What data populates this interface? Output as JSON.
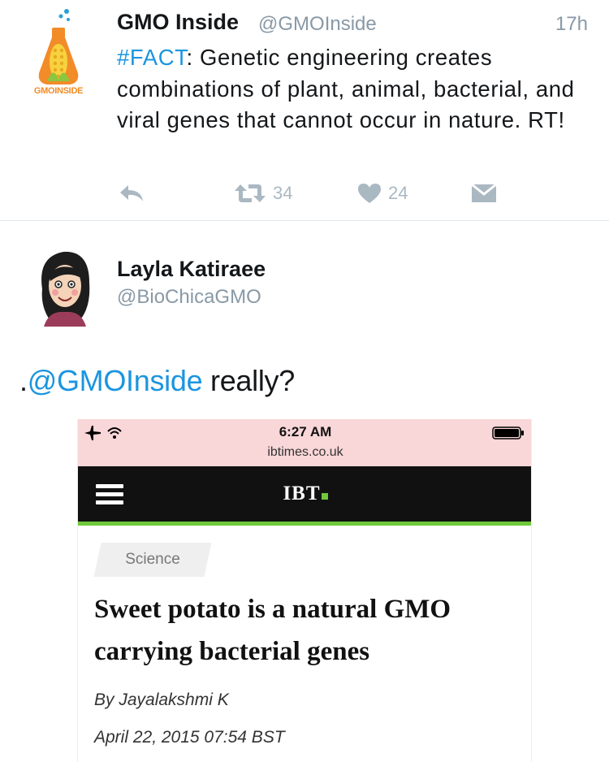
{
  "tweet1": {
    "name": "GMO Inside",
    "handle": "@GMOInside",
    "time": "17h",
    "hashtag": "#FACT",
    "text": ": Genetic engineering creates combinations of plant, animal, bacterial, and viral genes that cannot occur in nature. RT!",
    "avatar_text": "GMOINSIDE",
    "actions": {
      "retweet_count": "34",
      "like_count": "24"
    }
  },
  "tweet2": {
    "name": "Layla Katiraee",
    "handle": "@BioChicaGMO",
    "text_prefix": ".",
    "mention": "@GMOInside",
    "text_suffix": " really?"
  },
  "screenshot": {
    "time": "6:27 AM",
    "url": "ibtimes.co.uk",
    "logo": "IBT",
    "category": "Science",
    "headline": "Sweet potato is a natural GMO carrying bacterial genes",
    "byline": "By Jayalakshmi K",
    "date": "April 22, 2015 07:54 BST"
  },
  "colors": {
    "link": "#1b95e0",
    "muted": "#8899a6",
    "action": "#aab8c2",
    "status_bar": "#f9d6d8",
    "nav": "#111111",
    "accent_green": "#6fc93b",
    "avatar_orange": "#f28c28"
  }
}
